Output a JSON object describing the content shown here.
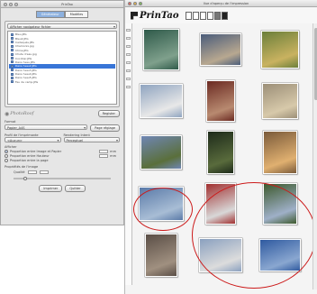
{
  "left_window": {
    "title": "PrinTao",
    "tabs": [
      {
        "label": "Générateur"
      },
      {
        "label": "Modèles"
      }
    ],
    "source_select": "Afficher navigateur fichier",
    "files": [
      {
        "name": "Bleu.JPG"
      },
      {
        "name": "Bleu2.JPG"
      },
      {
        "name": "Cadaqués.JPG"
      },
      {
        "name": "Chamonix.jpg"
      },
      {
        "name": "Chine.JPG"
      },
      {
        "name": "Chute d'eau.jpg"
      },
      {
        "name": "Cocotier.JPG"
      },
      {
        "name": "Dans l'eau.JPG"
      },
      {
        "name": "Dans l'eau2.JPG"
      },
      {
        "name": "Dans l'eau3.JPG"
      },
      {
        "name": "Dans l'eau4.JPG"
      },
      {
        "name": "Dans l'eau5.JPG"
      },
      {
        "name": "Feu de camp.JPG"
      }
    ],
    "selected_file_index": 8,
    "logo_text": "PhotoRoof",
    "register_button": "Register",
    "format_label": "Format",
    "format_value": "Papier_A4S",
    "page_setup_button": "Page réglage",
    "profile_label": "Profil de l'imprimante",
    "profile_value": "<Aucun>",
    "rendering_label": "Rendering Intent",
    "rendering_value": "Perceptuel",
    "options_heading": "Afficher",
    "radio_options": [
      {
        "label": "Proportion entre Image et Papier",
        "checked": true
      },
      {
        "label": "Proportion entre Hauteur",
        "checked": false
      },
      {
        "label": "Proportion entre la page",
        "checked": false
      }
    ],
    "size_unit": "mm",
    "quality_heading": "Propriétés de l'image",
    "quality_label": "Qualité",
    "slider_value_percent": 10,
    "print_button": "Imprimer",
    "quit_button": "Quitter"
  },
  "main_window": {
    "title": "Vue d'aperçu de l'impression",
    "brand_name": "PrinTao",
    "photos": [
      {
        "id": "agave",
        "colors": [
          "#2f5a4a",
          "#7fa08c"
        ]
      },
      {
        "id": "street-scene",
        "colors": [
          "#4a5c7a",
          "#b8a890"
        ]
      },
      {
        "id": "palm-tree",
        "colors": [
          "#6b7f3a",
          "#c9b260"
        ]
      },
      {
        "id": "airplane",
        "colors": [
          "#8fa4c0",
          "#e8e8e8"
        ]
      },
      {
        "id": "red-shop",
        "colors": [
          "#6b2a22",
          "#b88a70"
        ]
      },
      {
        "id": "courtyard",
        "colors": [
          "#9c8f78",
          "#d7c9aa"
        ]
      },
      {
        "id": "coast-road",
        "colors": [
          "#6f86b4",
          "#5a6f3b"
        ]
      },
      {
        "id": "dark-bush",
        "colors": [
          "#1d2a1a",
          "#596b3c"
        ]
      },
      {
        "id": "archway",
        "colors": [
          "#7a5a3a",
          "#e0b070"
        ]
      },
      {
        "id": "bay-view",
        "colors": [
          "#5a7aa8",
          "#a8bdd5"
        ]
      },
      {
        "id": "red-flower-wall",
        "colors": [
          "#a13030",
          "#d8d8d8"
        ]
      },
      {
        "id": "palms-road",
        "colors": [
          "#3e5a2e",
          "#9fb0c8"
        ]
      },
      {
        "id": "old-buildings",
        "colors": [
          "#5a4e46",
          "#a09080"
        ]
      },
      {
        "id": "airport",
        "colors": [
          "#8aa0bf",
          "#dcdcdc"
        ]
      },
      {
        "id": "sea-cliff",
        "colors": [
          "#2f5aa0",
          "#8aa7d0"
        ]
      }
    ],
    "highlight_color": "#cc1a1a"
  }
}
